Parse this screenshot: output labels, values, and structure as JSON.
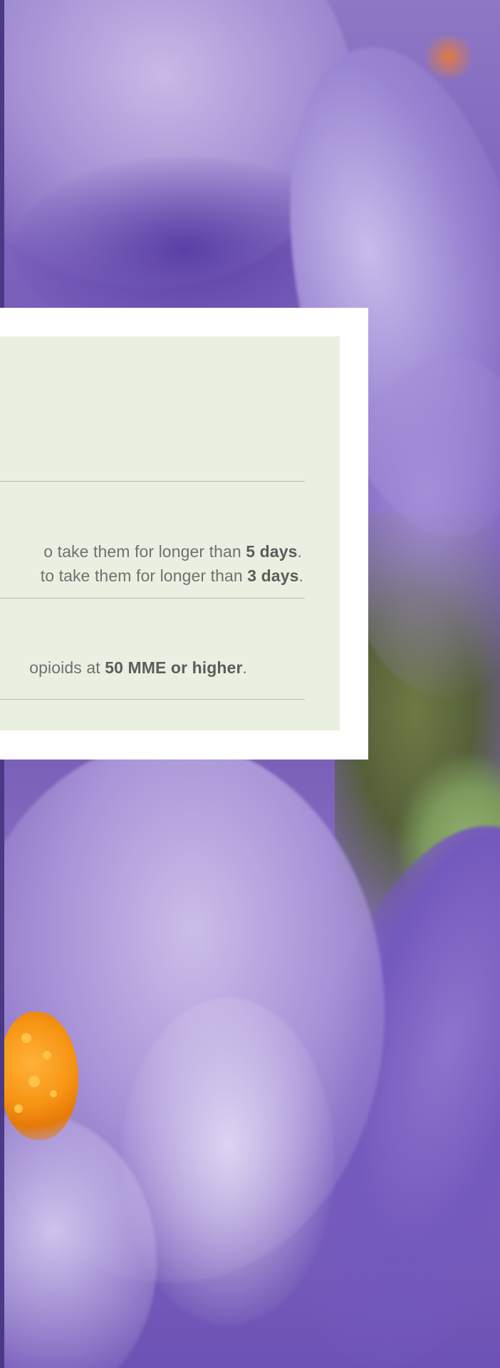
{
  "card": {
    "lines": [
      {
        "prefix": "o take them for longer than ",
        "emphasis": "5 days",
        "suffix": "."
      },
      {
        "prefix": " to take them for longer than ",
        "emphasis": "3 days",
        "suffix": "."
      },
      {
        "prefix": "opioids at ",
        "emphasis": "50 MME or higher",
        "suffix": "."
      }
    ]
  },
  "colors": {
    "card_frame": "#ffffff",
    "card_panel": "#e9f0e1",
    "text": "#707070",
    "divider": "#b7bdb2",
    "petal_purple": "#7d63bd",
    "stamen_orange": "#f79514"
  }
}
